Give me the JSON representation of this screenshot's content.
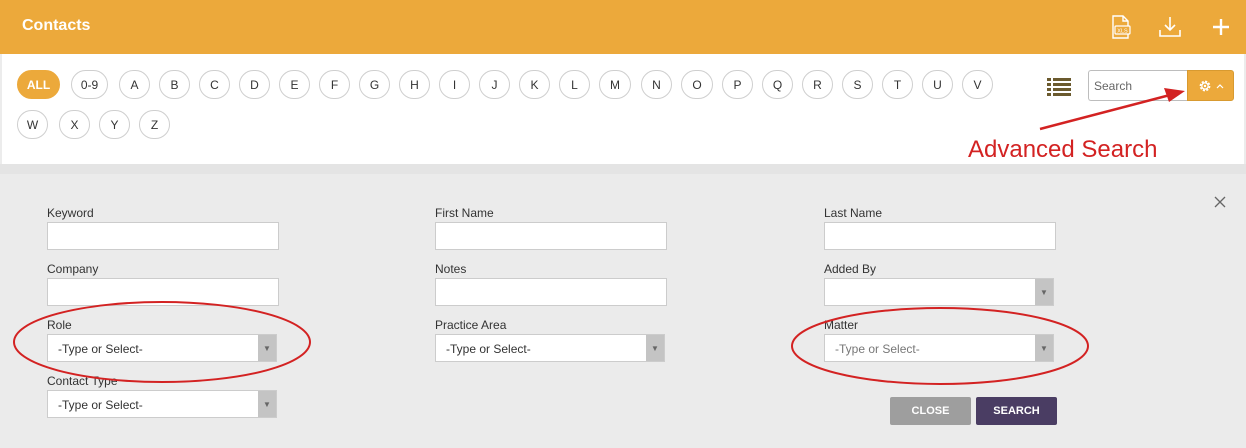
{
  "header": {
    "title": "Contacts",
    "export_icon_text": "XLS"
  },
  "alphabet": [
    "ALL",
    "0-9",
    "A",
    "B",
    "C",
    "D",
    "E",
    "F",
    "G",
    "H",
    "I",
    "J",
    "K",
    "L",
    "M",
    "N",
    "O",
    "P",
    "Q",
    "R",
    "S",
    "T",
    "U",
    "V",
    "W",
    "X",
    "Y",
    "Z"
  ],
  "search": {
    "placeholder": "Search"
  },
  "annotation": {
    "text": "Advanced Search"
  },
  "advanced_search": {
    "keyword_label": "Keyword",
    "first_name_label": "First Name",
    "last_name_label": "Last Name",
    "company_label": "Company",
    "notes_label": "Notes",
    "added_by_label": "Added By",
    "role_label": "Role",
    "role_value": "-Type or Select-",
    "practice_area_label": "Practice Area",
    "practice_area_value": "-Type or Select-",
    "matter_label": "Matter",
    "matter_value": "-Type or Select-",
    "contact_type_label": "Contact Type",
    "contact_type_value": "-Type or Select-",
    "close_button": "CLOSE",
    "search_button": "SEARCH"
  },
  "colors": {
    "accent": "#eca93b",
    "annotation": "#d32222",
    "search_button": "#4a3d63",
    "close_button": "#9e9e9e"
  }
}
